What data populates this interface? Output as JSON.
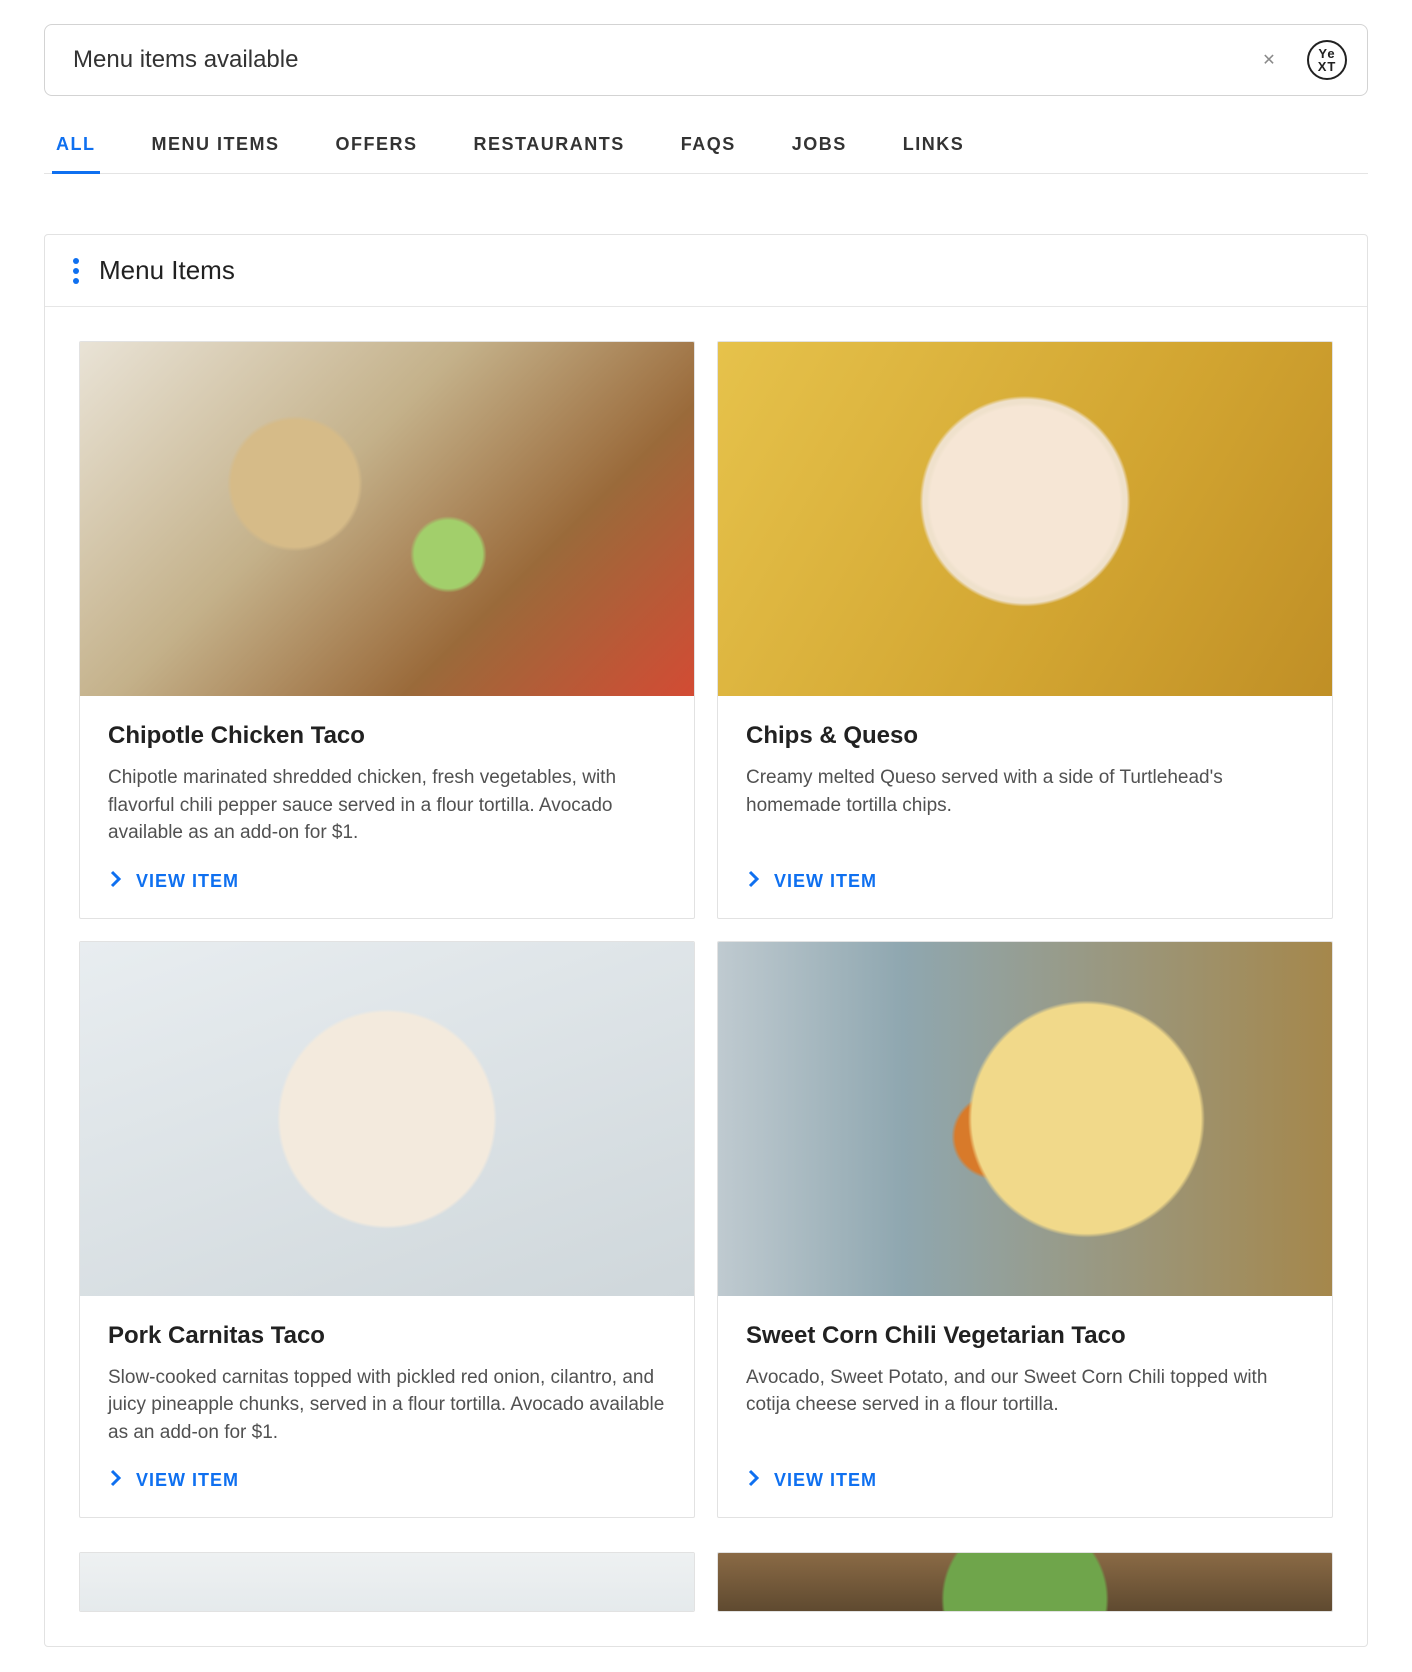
{
  "search": {
    "value": "Menu items available"
  },
  "brand_icon": {
    "line1": "Ye",
    "line2": "XT"
  },
  "tabs": [
    {
      "label": "ALL",
      "active": true
    },
    {
      "label": "MENU ITEMS",
      "active": false
    },
    {
      "label": "OFFERS",
      "active": false
    },
    {
      "label": "RESTAURANTS",
      "active": false
    },
    {
      "label": "FAQS",
      "active": false
    },
    {
      "label": "JOBS",
      "active": false
    },
    {
      "label": "LINKS",
      "active": false
    }
  ],
  "section": {
    "title": "Menu Items",
    "view_label": "VIEW ITEM"
  },
  "cards": [
    {
      "title": "Chipotle Chicken Taco",
      "desc": "Chipotle marinated shredded chicken, fresh vegetables, with flavorful chili pepper sauce served in a flour tortilla. Avocado available as an add-on for $1.",
      "imgClass": "img-1"
    },
    {
      "title": "Chips & Queso",
      "desc": "Creamy melted Queso served with a side of Turtlehead's homemade tortilla chips.",
      "imgClass": "img-2"
    },
    {
      "title": "Pork Carnitas Taco",
      "desc": "Slow-cooked carnitas topped with pickled red onion, cilantro, and juicy pineapple chunks, served in a flour tortilla. Avocado available as an add-on for $1.",
      "imgClass": "img-3"
    },
    {
      "title": "Sweet Corn Chili Vegetarian Taco",
      "desc": "Avocado, Sweet Potato, and our Sweet Corn Chili topped with cotija cheese served in a flour tortilla.",
      "imgClass": "img-4"
    }
  ],
  "partial_cards": [
    {
      "imgClass": "img-5"
    },
    {
      "imgClass": "img-6"
    }
  ]
}
